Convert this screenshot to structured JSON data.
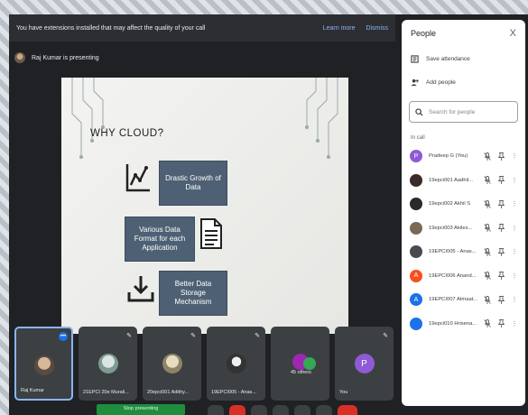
{
  "banner": {
    "message": "You have extensions installed that may affect the quality of your call",
    "learn_more": "Learn more",
    "dismiss": "Dismiss"
  },
  "presenting_text": "Raj Kumar is presenting",
  "slide": {
    "title": "WHY CLOUD?",
    "box1": "Drastic Growth of Data",
    "box2": "Various Data Format for each Application",
    "box3": "Better Data Storage Mechanism"
  },
  "panel": {
    "title": "People",
    "close": "X",
    "save_attendance": "Save attendance",
    "add_people": "Add people",
    "search_placeholder": "Search for people",
    "in_call": "In call",
    "participants": [
      {
        "name": "Pradeep G (You)",
        "avatar_letter": "P",
        "color": "#8e5ad6"
      },
      {
        "name": "19epci001 Aadhil...",
        "avatar_letter": "",
        "color": "#3a2a2a"
      },
      {
        "name": "19epci002 Akhil S",
        "avatar_letter": "",
        "color": "#2a2a2a"
      },
      {
        "name": "19epci003 Akiles...",
        "avatar_letter": "",
        "color": "#7a6a55"
      },
      {
        "name": "19EPCI005 - Anas...",
        "avatar_letter": "",
        "color": "#4a4a50"
      },
      {
        "name": "19EPCI006 Anand...",
        "avatar_letter": "A",
        "color": "#f4511e"
      },
      {
        "name": "19EPCI007 Atmaat...",
        "avatar_letter": "A",
        "color": "#1a73e8"
      },
      {
        "name": "19epci010 Hrisena...",
        "avatar_letter": "",
        "color": "#1a73e8"
      }
    ]
  },
  "tiles": [
    {
      "name": "Raj Kumar",
      "color": "#8a7a70"
    },
    {
      "name": "21EPCI 20e Murali...",
      "color": "#a8b8b0"
    },
    {
      "name": "20epci001 Adithy...",
      "color": "#c8c0a8"
    },
    {
      "name": "19EPCI005 - Anas...",
      "color": "#555"
    },
    {
      "name": "45 others",
      "color": "#9c27b0"
    },
    {
      "name": "You",
      "avatar_letter": "P",
      "color": "#8e5ad6"
    }
  ],
  "bottom": {
    "green_button": "Stop presenting"
  }
}
